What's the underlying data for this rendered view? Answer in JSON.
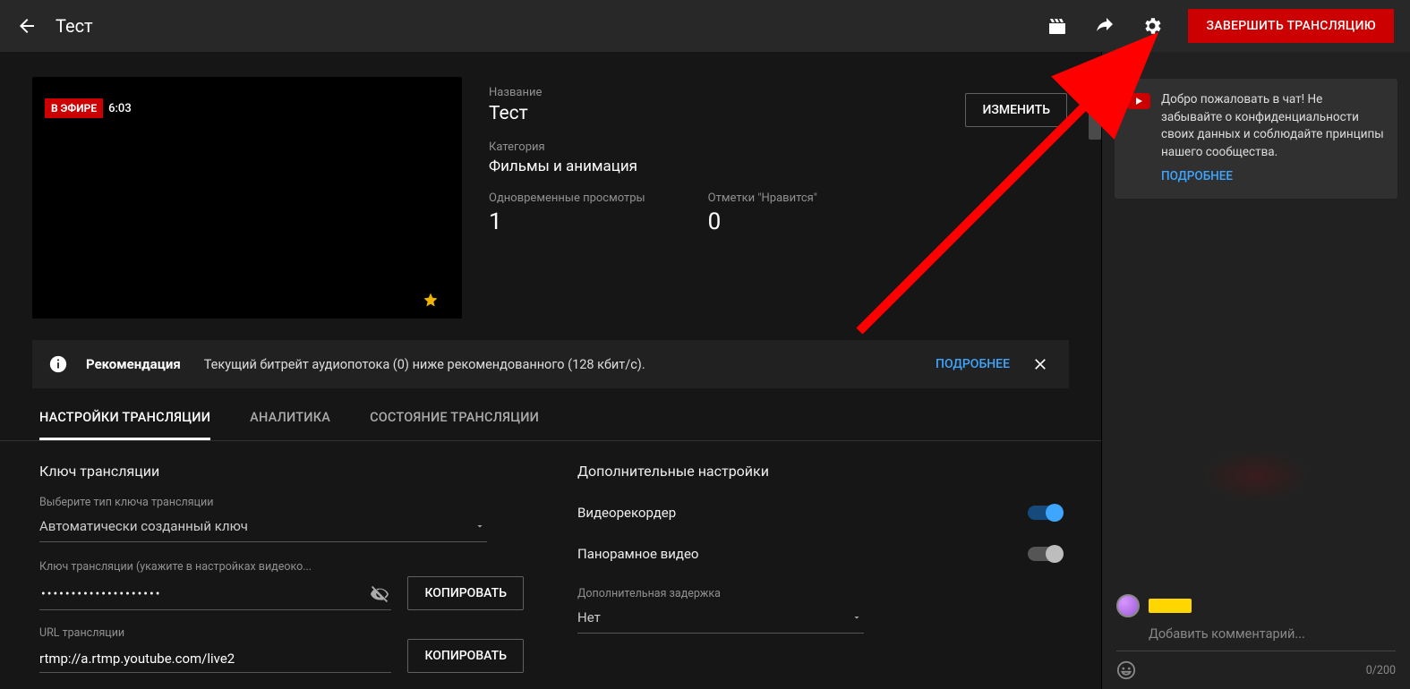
{
  "header": {
    "title": "Тест",
    "end_button": "ЗАВЕРШИТЬ ТРАНСЛЯЦИЮ"
  },
  "preview": {
    "live_badge": "В ЭФИРЕ",
    "elapsed": "6:03"
  },
  "meta": {
    "title_label": "Название",
    "title_value": "Тест",
    "category_label": "Категория",
    "category_value": "Фильмы и анимация",
    "viewers_label": "Одновременные просмотры",
    "viewers_value": "1",
    "likes_label": "Отметки \"Нравится\"",
    "likes_value": "0",
    "edit_button": "ИЗМЕНИТЬ"
  },
  "notice": {
    "title": "Рекомендация",
    "text": "Текущий битрейт аудиопотока (0) ниже рекомендованного (128 кбит/с).",
    "more": "ПОДРОБНЕЕ"
  },
  "tabs": [
    "НАСТРОЙКИ ТРАНСЛЯЦИИ",
    "АНАЛИТИКА",
    "СОСТОЯНИЕ ТРАНСЛЯЦИИ"
  ],
  "stream_key": {
    "section_title": "Ключ трансляции",
    "type_label": "Выберите тип ключа трансляции",
    "type_value": "Автоматически созданный ключ",
    "key_label": "Ключ трансляции (укажите в настройках видеоко...",
    "key_masked": "••••••••••••••••••••",
    "copy": "КОПИРОВАТЬ",
    "url_label": "URL трансляции",
    "url_value": "rtmp://a.rtmp.youtube.com/live2"
  },
  "extra": {
    "section_title": "Дополнительные настройки",
    "dvr": "Видеорекордер",
    "pano": "Панорамное видео",
    "delay_label": "Дополнительная задержка",
    "delay_value": "Нет"
  },
  "chat": {
    "welcome": "Добро пожаловать в чат! Не забывайте о конфиденциальности своих данных и соблюдайте принципы нашего сообщества.",
    "more": "ПОДРОБНЕЕ",
    "placeholder": "Добавить комментарий...",
    "counter": "0/200"
  }
}
